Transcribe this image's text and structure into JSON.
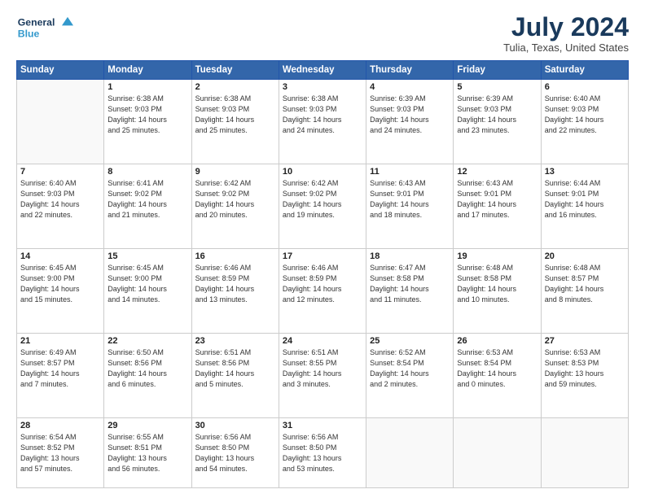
{
  "logo": {
    "line1": "General",
    "line2": "Blue"
  },
  "title": "July 2024",
  "subtitle": "Tulia, Texas, United States",
  "headers": [
    "Sunday",
    "Monday",
    "Tuesday",
    "Wednesday",
    "Thursday",
    "Friday",
    "Saturday"
  ],
  "weeks": [
    [
      {
        "num": "",
        "info": ""
      },
      {
        "num": "1",
        "info": "Sunrise: 6:38 AM\nSunset: 9:03 PM\nDaylight: 14 hours\nand 25 minutes."
      },
      {
        "num": "2",
        "info": "Sunrise: 6:38 AM\nSunset: 9:03 PM\nDaylight: 14 hours\nand 25 minutes."
      },
      {
        "num": "3",
        "info": "Sunrise: 6:38 AM\nSunset: 9:03 PM\nDaylight: 14 hours\nand 24 minutes."
      },
      {
        "num": "4",
        "info": "Sunrise: 6:39 AM\nSunset: 9:03 PM\nDaylight: 14 hours\nand 24 minutes."
      },
      {
        "num": "5",
        "info": "Sunrise: 6:39 AM\nSunset: 9:03 PM\nDaylight: 14 hours\nand 23 minutes."
      },
      {
        "num": "6",
        "info": "Sunrise: 6:40 AM\nSunset: 9:03 PM\nDaylight: 14 hours\nand 22 minutes."
      }
    ],
    [
      {
        "num": "7",
        "info": "Sunrise: 6:40 AM\nSunset: 9:03 PM\nDaylight: 14 hours\nand 22 minutes."
      },
      {
        "num": "8",
        "info": "Sunrise: 6:41 AM\nSunset: 9:02 PM\nDaylight: 14 hours\nand 21 minutes."
      },
      {
        "num": "9",
        "info": "Sunrise: 6:42 AM\nSunset: 9:02 PM\nDaylight: 14 hours\nand 20 minutes."
      },
      {
        "num": "10",
        "info": "Sunrise: 6:42 AM\nSunset: 9:02 PM\nDaylight: 14 hours\nand 19 minutes."
      },
      {
        "num": "11",
        "info": "Sunrise: 6:43 AM\nSunset: 9:01 PM\nDaylight: 14 hours\nand 18 minutes."
      },
      {
        "num": "12",
        "info": "Sunrise: 6:43 AM\nSunset: 9:01 PM\nDaylight: 14 hours\nand 17 minutes."
      },
      {
        "num": "13",
        "info": "Sunrise: 6:44 AM\nSunset: 9:01 PM\nDaylight: 14 hours\nand 16 minutes."
      }
    ],
    [
      {
        "num": "14",
        "info": "Sunrise: 6:45 AM\nSunset: 9:00 PM\nDaylight: 14 hours\nand 15 minutes."
      },
      {
        "num": "15",
        "info": "Sunrise: 6:45 AM\nSunset: 9:00 PM\nDaylight: 14 hours\nand 14 minutes."
      },
      {
        "num": "16",
        "info": "Sunrise: 6:46 AM\nSunset: 8:59 PM\nDaylight: 14 hours\nand 13 minutes."
      },
      {
        "num": "17",
        "info": "Sunrise: 6:46 AM\nSunset: 8:59 PM\nDaylight: 14 hours\nand 12 minutes."
      },
      {
        "num": "18",
        "info": "Sunrise: 6:47 AM\nSunset: 8:58 PM\nDaylight: 14 hours\nand 11 minutes."
      },
      {
        "num": "19",
        "info": "Sunrise: 6:48 AM\nSunset: 8:58 PM\nDaylight: 14 hours\nand 10 minutes."
      },
      {
        "num": "20",
        "info": "Sunrise: 6:48 AM\nSunset: 8:57 PM\nDaylight: 14 hours\nand 8 minutes."
      }
    ],
    [
      {
        "num": "21",
        "info": "Sunrise: 6:49 AM\nSunset: 8:57 PM\nDaylight: 14 hours\nand 7 minutes."
      },
      {
        "num": "22",
        "info": "Sunrise: 6:50 AM\nSunset: 8:56 PM\nDaylight: 14 hours\nand 6 minutes."
      },
      {
        "num": "23",
        "info": "Sunrise: 6:51 AM\nSunset: 8:56 PM\nDaylight: 14 hours\nand 5 minutes."
      },
      {
        "num": "24",
        "info": "Sunrise: 6:51 AM\nSunset: 8:55 PM\nDaylight: 14 hours\nand 3 minutes."
      },
      {
        "num": "25",
        "info": "Sunrise: 6:52 AM\nSunset: 8:54 PM\nDaylight: 14 hours\nand 2 minutes."
      },
      {
        "num": "26",
        "info": "Sunrise: 6:53 AM\nSunset: 8:54 PM\nDaylight: 14 hours\nand 0 minutes."
      },
      {
        "num": "27",
        "info": "Sunrise: 6:53 AM\nSunset: 8:53 PM\nDaylight: 13 hours\nand 59 minutes."
      }
    ],
    [
      {
        "num": "28",
        "info": "Sunrise: 6:54 AM\nSunset: 8:52 PM\nDaylight: 13 hours\nand 57 minutes."
      },
      {
        "num": "29",
        "info": "Sunrise: 6:55 AM\nSunset: 8:51 PM\nDaylight: 13 hours\nand 56 minutes."
      },
      {
        "num": "30",
        "info": "Sunrise: 6:56 AM\nSunset: 8:50 PM\nDaylight: 13 hours\nand 54 minutes."
      },
      {
        "num": "31",
        "info": "Sunrise: 6:56 AM\nSunset: 8:50 PM\nDaylight: 13 hours\nand 53 minutes."
      },
      {
        "num": "",
        "info": ""
      },
      {
        "num": "",
        "info": ""
      },
      {
        "num": "",
        "info": ""
      }
    ]
  ]
}
